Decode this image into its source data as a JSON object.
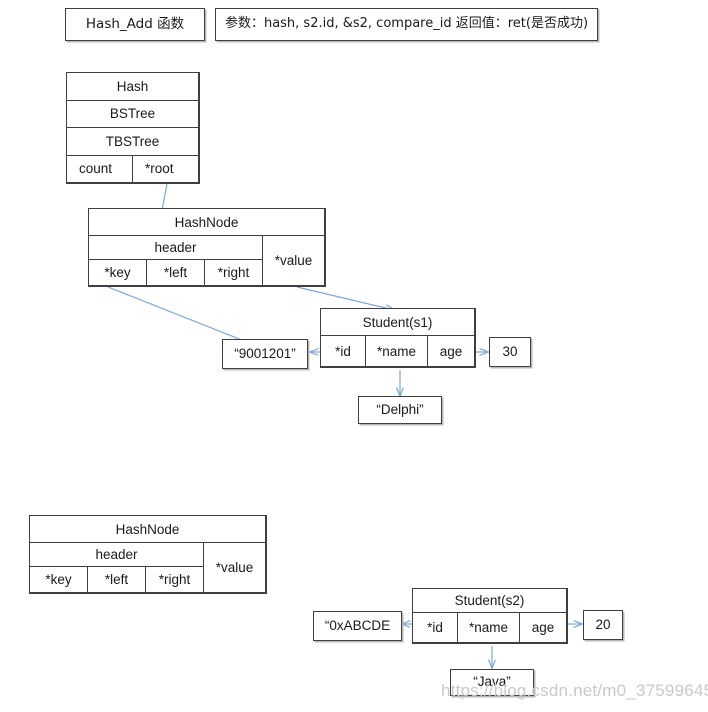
{
  "page": {
    "watermark": "https://blog.csdn.net/m0_37599645"
  },
  "header": {
    "function_box": "Hash_Add 函数",
    "signature_box": "参数：hash, s2.id, &s2, compare_id  返回值：ret(是否成功)"
  },
  "hash_struct": {
    "title": "Hash",
    "rows": [
      "BSTree",
      "TBSTree"
    ],
    "fields": [
      "count",
      "*root"
    ]
  },
  "hashnode_top": {
    "title": "HashNode",
    "header_label": "header",
    "value_label": "*value",
    "fields": [
      "*key",
      "*left",
      "*right"
    ]
  },
  "hashnode_bottom": {
    "title": "HashNode",
    "header_label": "header",
    "value_label": "*value",
    "fields": [
      "*key",
      "*left",
      "*right"
    ]
  },
  "student_s1": {
    "title": "Student(s1)",
    "fields": [
      "*id",
      "*name",
      "age"
    ],
    "id_value": "“9001201”",
    "name_value": "“Delphi”",
    "age_value": "30"
  },
  "student_s2": {
    "title": "Student(s2)",
    "fields": [
      "*id",
      "*name",
      "age"
    ],
    "id_value": "“0xABCDE",
    "name_value": "“Java”",
    "age_value": "20"
  },
  "colors": {
    "arrow": "#7ba7d7",
    "border": "#3f3f3f",
    "watermark": "#c9c9c9"
  }
}
